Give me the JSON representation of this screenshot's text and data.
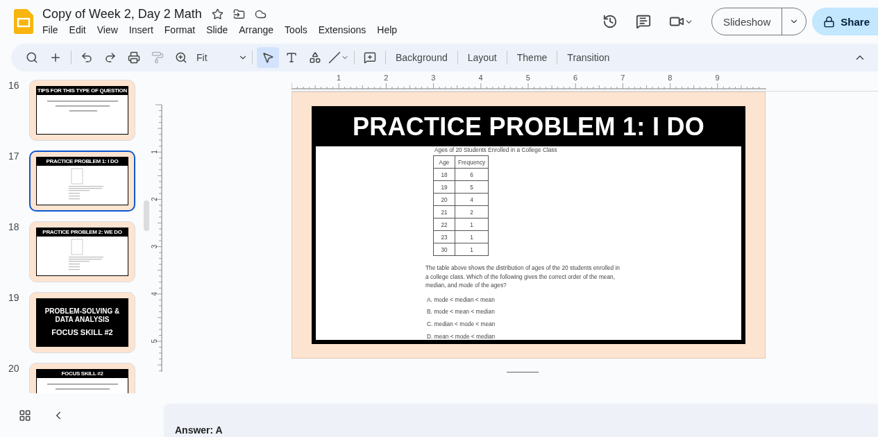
{
  "app": {
    "title": "Copy of Week 2, Day 2 Math",
    "menu": [
      "File",
      "Edit",
      "View",
      "Insert",
      "Format",
      "Slide",
      "Arrange",
      "Tools",
      "Extensions",
      "Help"
    ],
    "slideshow_button": "Slideshow",
    "share_button": "Share"
  },
  "toolbar": {
    "zoom": "Fit",
    "buttons": [
      "Background",
      "Layout",
      "Theme",
      "Transition"
    ]
  },
  "filmstrip": [
    {
      "number": "16",
      "selected": false,
      "kind": "content",
      "title": "TIPS FOR THIS TYPE OF QUESTION"
    },
    {
      "number": "17",
      "selected": true,
      "kind": "problem",
      "title": "PRACTICE PROBLEM 1: I DO"
    },
    {
      "number": "18",
      "selected": false,
      "kind": "problem",
      "title": "PRACTICE PROBLEM 2: WE DO"
    },
    {
      "number": "19",
      "selected": false,
      "kind": "section",
      "lines": [
        "PROBLEM-SOLVING & DATA ANALYSIS",
        "FOCUS SKILL #2"
      ]
    },
    {
      "number": "20",
      "selected": false,
      "kind": "content",
      "title": "FOCUS SKILL #2"
    }
  ],
  "ruler": {
    "horizontal": [
      "1",
      "2",
      "3",
      "4",
      "5",
      "6",
      "7",
      "8",
      "9"
    ],
    "vertical": [
      "1",
      "2",
      "3",
      "4",
      "5"
    ]
  },
  "slide": {
    "title": "PRACTICE PROBLEM 1: I DO",
    "table_caption": "Ages of 20 Students Enrolled in a College Class",
    "columns": [
      "Age",
      "Frequency"
    ],
    "rows": [
      [
        "18",
        "6"
      ],
      [
        "19",
        "5"
      ],
      [
        "20",
        "4"
      ],
      [
        "21",
        "2"
      ],
      [
        "22",
        "1"
      ],
      [
        "23",
        "1"
      ],
      [
        "30",
        "1"
      ]
    ],
    "question": "The table above shows the distribution of ages of the 20 students enrolled in a college class. Which of the following gives the correct order of the mean, median, and mode of the ages?",
    "choices": [
      "A. mode < median < mean",
      "B. mode < mean < median",
      "C. median < mode < mean",
      "D. mean < mode < median"
    ]
  },
  "notes": {
    "text": "Answer: A"
  }
}
